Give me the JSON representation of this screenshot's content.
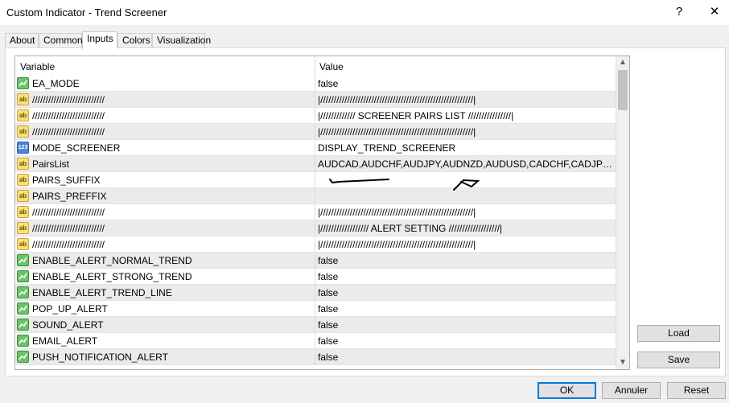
{
  "window": {
    "title": "Custom Indicator - Trend Screener",
    "help_glyph": "?",
    "close_glyph": "✕"
  },
  "tabs": [
    {
      "label": "About"
    },
    {
      "label": "Common"
    },
    {
      "label": "Inputs"
    },
    {
      "label": "Colors"
    },
    {
      "label": "Visualization"
    }
  ],
  "grid": {
    "col_variable": "Variable",
    "col_value": "Value",
    "rows": [
      {
        "icon": "bool",
        "name": "EA_MODE",
        "value": "false"
      },
      {
        "icon": "ab",
        "name": "///////////////////////////",
        "value": "|/////////////////////////////////////////////////////////|"
      },
      {
        "icon": "ab",
        "name": "///////////////////////////",
        "value": "|///////////// SCREENER PAIRS LIST ////////////////|"
      },
      {
        "icon": "ab",
        "name": "///////////////////////////",
        "value": "|/////////////////////////////////////////////////////////|"
      },
      {
        "icon": "num",
        "name": "MODE_SCREENER",
        "value": "DISPLAY_TREND_SCREENER"
      },
      {
        "icon": "ab",
        "name": "PairsList",
        "value": "AUDCAD,AUDCHF,AUDJPY,AUDNZD,AUDUSD,CADCHF,CADJPY,CHFJPY,EURAUD"
      },
      {
        "icon": "ab",
        "name": "PAIRS_SUFFIX",
        "value": ""
      },
      {
        "icon": "ab",
        "name": "PAIRS_PREFFIX",
        "value": ""
      },
      {
        "icon": "ab",
        "name": "///////////////////////////",
        "value": "|/////////////////////////////////////////////////////////|"
      },
      {
        "icon": "ab",
        "name": "///////////////////////////",
        "value": "|////////////////// ALERT SETTING ///////////////////|"
      },
      {
        "icon": "ab",
        "name": "///////////////////////////",
        "value": "|/////////////////////////////////////////////////////////|"
      },
      {
        "icon": "bool",
        "name": "ENABLE_ALERT_NORMAL_TREND",
        "value": "false"
      },
      {
        "icon": "bool",
        "name": "ENABLE_ALERT_STRONG_TREND",
        "value": "false"
      },
      {
        "icon": "bool",
        "name": "ENABLE_ALERT_TREND_LINE",
        "value": "false"
      },
      {
        "icon": "bool",
        "name": "POP_UP_ALERT",
        "value": "false"
      },
      {
        "icon": "bool",
        "name": "SOUND_ALERT",
        "value": "false"
      },
      {
        "icon": "bool",
        "name": "EMAIL_ALERT",
        "value": "false"
      },
      {
        "icon": "bool",
        "name": "PUSH_NOTIFICATION_ALERT",
        "value": "false"
      }
    ]
  },
  "side_buttons": {
    "load": "Load",
    "save": "Save"
  },
  "footer_buttons": {
    "ok": "OK",
    "cancel": "Annuler",
    "reset": "Reset"
  },
  "scroll": {
    "up": "▲",
    "down": "▼"
  }
}
